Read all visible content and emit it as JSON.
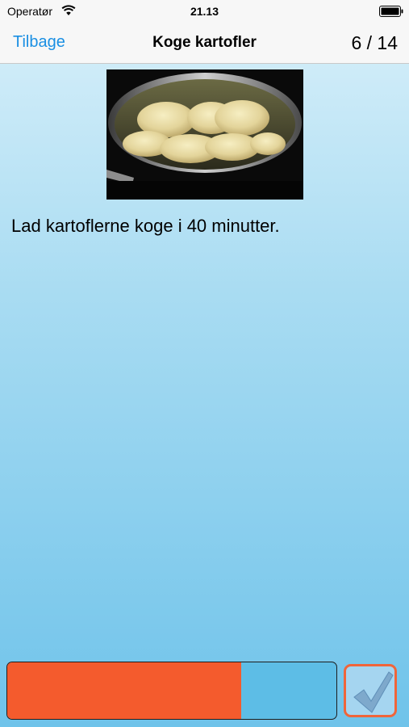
{
  "status_bar": {
    "carrier": "Operatør",
    "time": "21.13"
  },
  "nav": {
    "back_label": "Tilbage",
    "title": "Koge kartofler",
    "step_counter": "6 / 14"
  },
  "step": {
    "image_icon": "potatoes-boiling-photo",
    "text": "Lad kartoflerne koge i 40 minutter."
  },
  "progress": {
    "fraction": 0.71
  },
  "done_icon": "checkmark-icon",
  "colors": {
    "accent": "#1a8fe3",
    "progress_fill": "#f45b2d",
    "progress_track": "#5dbde6",
    "done_border": "#f0653a"
  }
}
